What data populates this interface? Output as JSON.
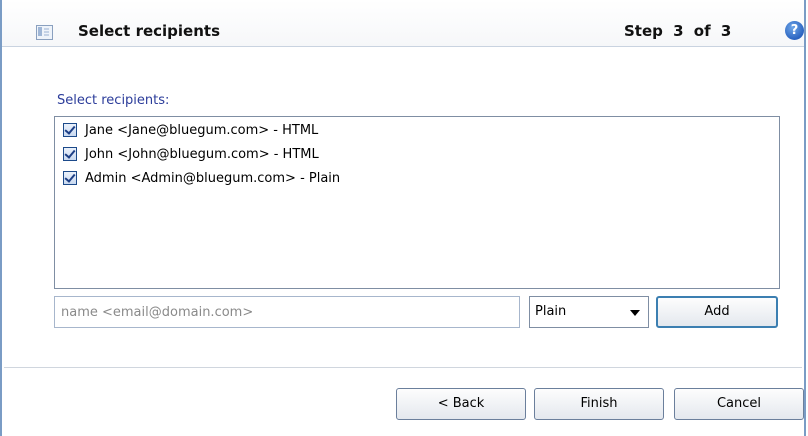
{
  "header": {
    "title": "Select recipients",
    "step": "Step 3 of 3",
    "help_label": "?"
  },
  "recipients": {
    "label": "Select recipients:",
    "items": [
      {
        "text": "Jane <Jane@bluegum.com> - HTML",
        "checked": true
      },
      {
        "text": "John <John@bluegum.com> - HTML",
        "checked": true
      },
      {
        "text": "Admin <Admin@bluegum.com> - Plain",
        "checked": true
      }
    ]
  },
  "add_form": {
    "placeholder": "name <email@domain.com>",
    "format_selected": "Plain",
    "add_label": "Add"
  },
  "footer": {
    "back_label": "< Back",
    "finish_label": "Finish",
    "cancel_label": "Cancel"
  },
  "colors": {
    "frame_border": "#7a9cc5",
    "label_blue": "#2b3c9a",
    "help_blue": "#2a63c0"
  },
  "icons": {
    "wizard": "wizard-icon",
    "help": "help-icon",
    "check": "checkbox-checked-icon",
    "dropdown": "chevron-down-icon"
  }
}
